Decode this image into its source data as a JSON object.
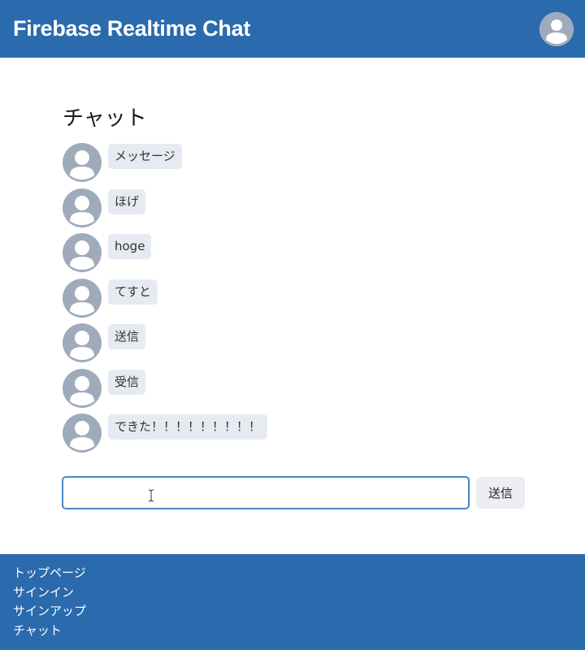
{
  "header": {
    "title": "Firebase Realtime Chat",
    "avatar_icon": "user-avatar-icon"
  },
  "chat": {
    "heading": "チャット",
    "messages": [
      {
        "text": "メッセージ"
      },
      {
        "text": "ほげ"
      },
      {
        "text": "hoge"
      },
      {
        "text": "てすと"
      },
      {
        "text": "送信"
      },
      {
        "text": "受信"
      },
      {
        "text": "できた！！！！！！！！！"
      }
    ]
  },
  "composer": {
    "input_value": "",
    "send_label": "送信"
  },
  "footer": {
    "links": [
      {
        "label": "トップページ"
      },
      {
        "label": "サインイン"
      },
      {
        "label": "サインアップ"
      },
      {
        "label": "チャット"
      }
    ]
  },
  "colors": {
    "brand": "#2a6aad",
    "bubble": "#e6eaf1",
    "avatar": "#9fabbb",
    "input_border": "#4a86c5"
  }
}
